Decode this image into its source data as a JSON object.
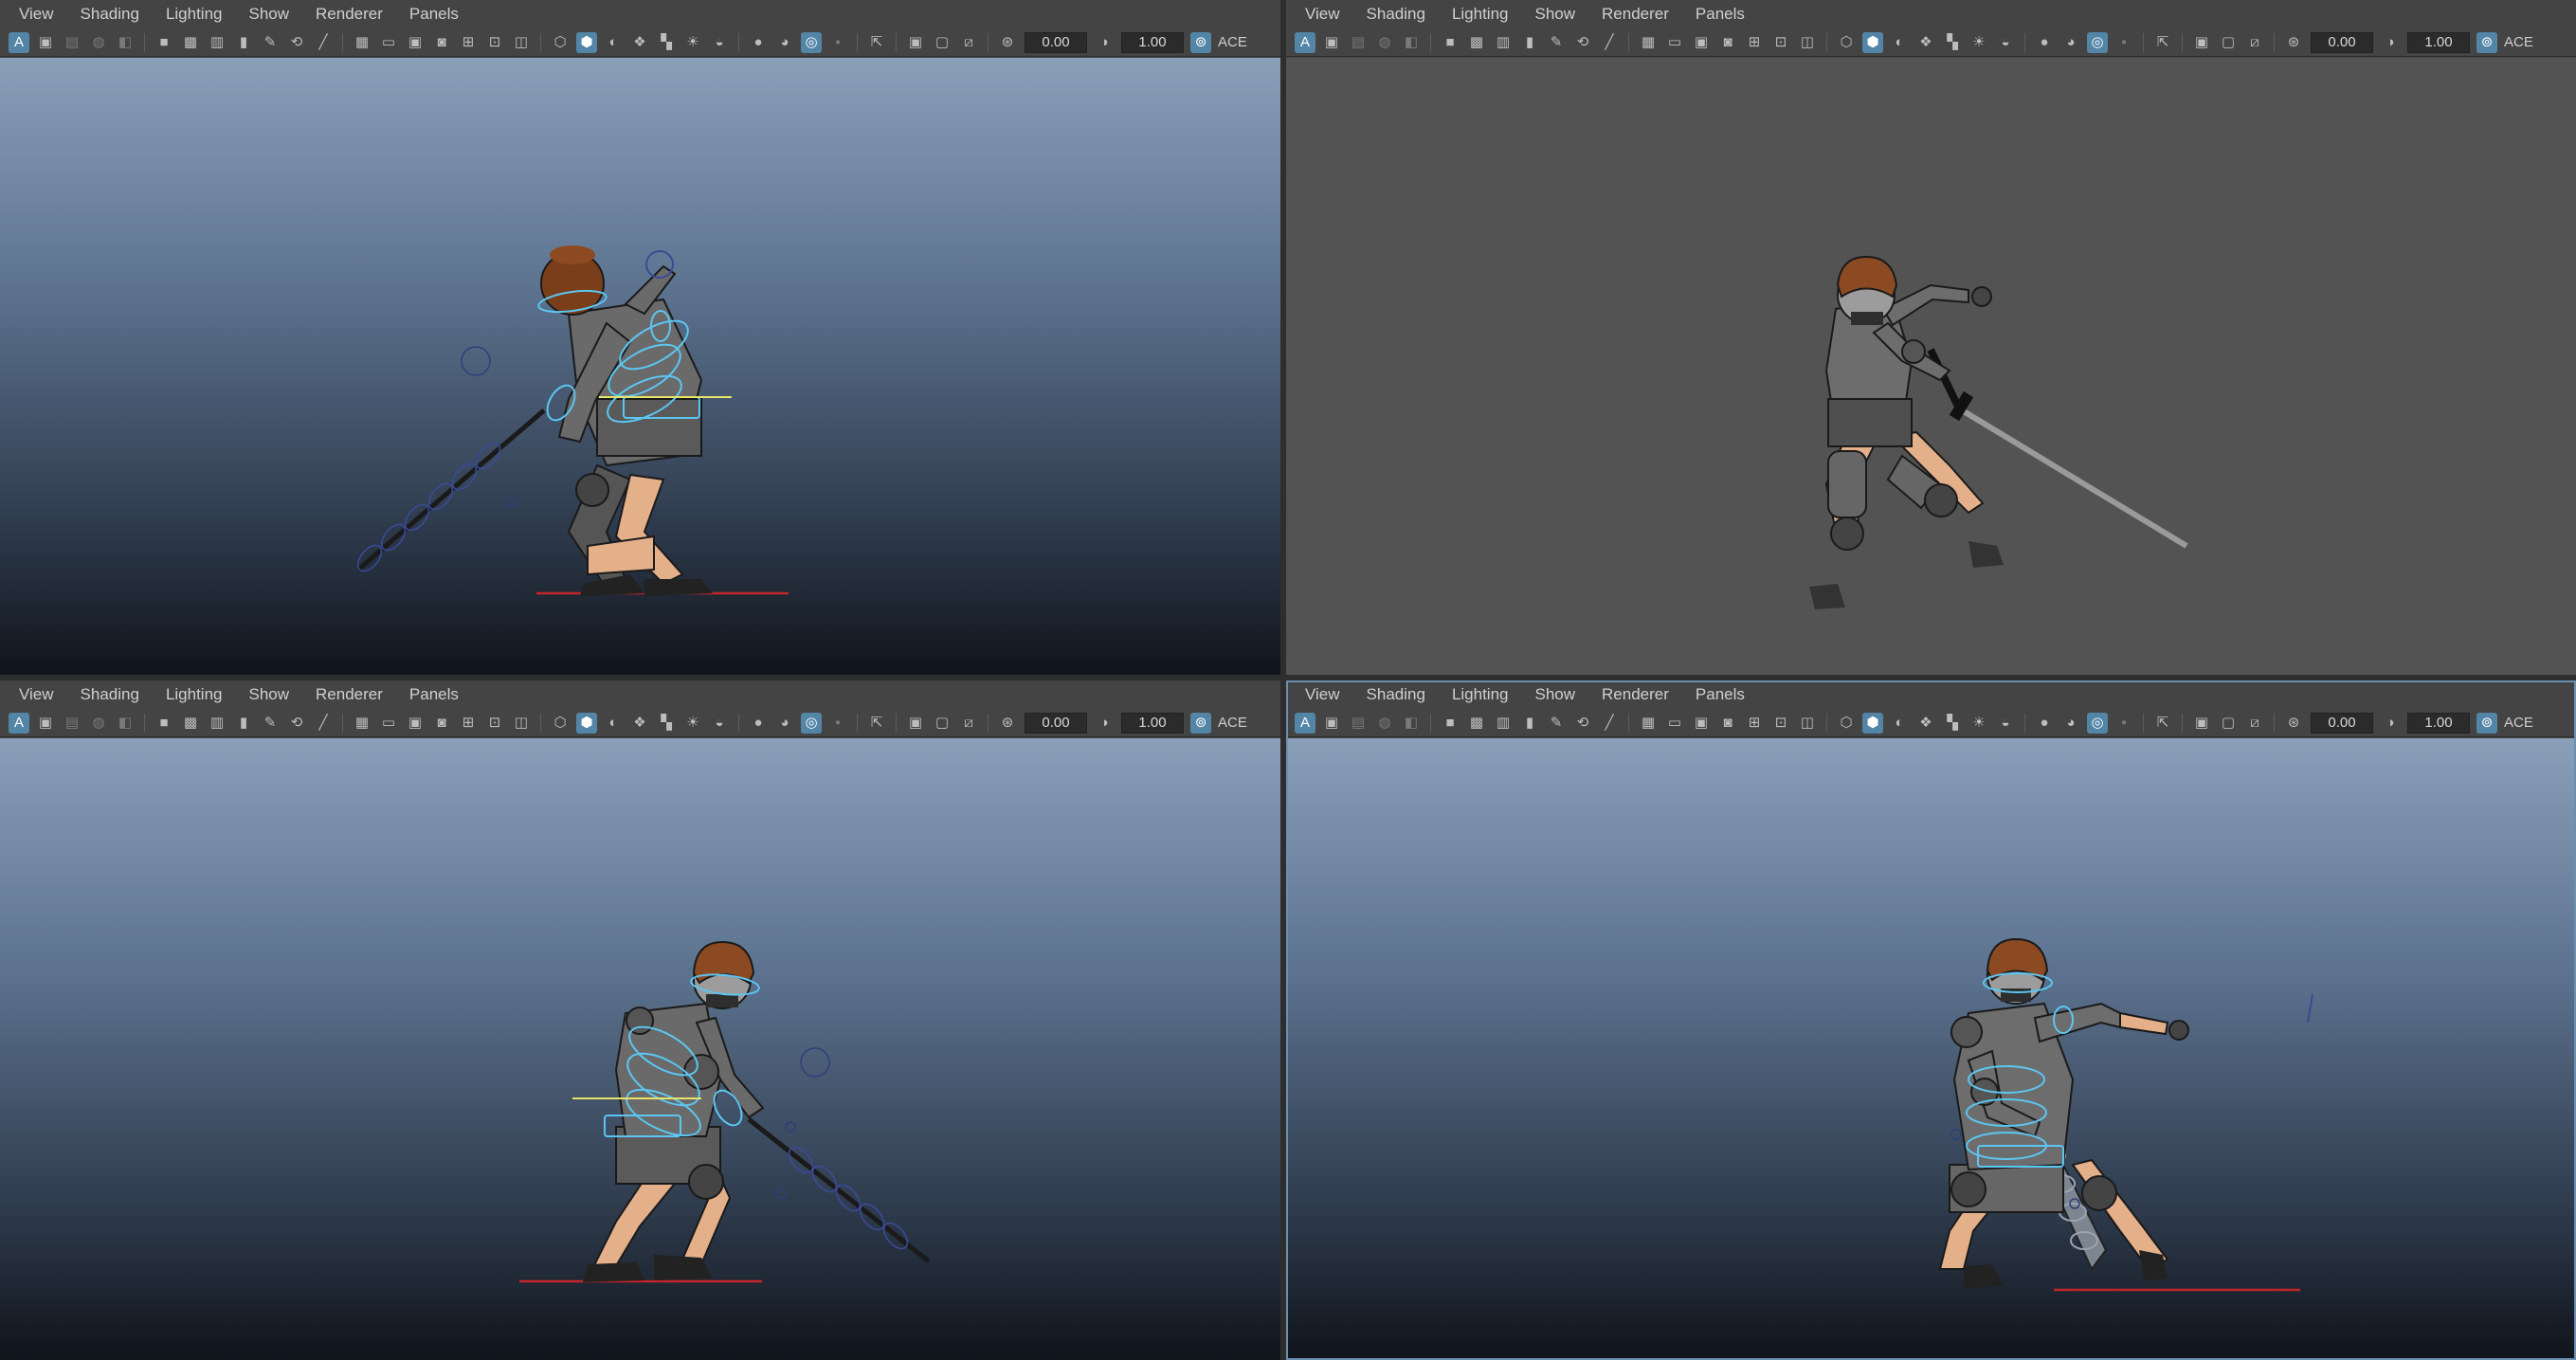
{
  "app": {
    "menus": [
      "View",
      "Shading",
      "Lighting",
      "Show",
      "Renderer",
      "Panels"
    ],
    "toolbar": {
      "exposure_value": "0.00",
      "gamma_value": "1.00",
      "color_mgmt_label": "ACE"
    },
    "toolbar_icons": [
      "select-camera-icon",
      "camera-attributes-icon",
      "bookmarks-icon",
      "image-plane-icon",
      "camera-icon",
      "grid-icon",
      "film-gate-icon",
      "resolution-gate-icon",
      "gate-mask-icon",
      "field-chart-icon",
      "safe-action-icon",
      "safe-title-icon",
      "wireframe-icon",
      "smooth-shade-icon",
      "textured-icon",
      "lighting-icon",
      "shadows-icon",
      "screen-ambient-occlusion-icon",
      "motion-blur-icon",
      "anti-aliasing-icon",
      "isolate-select-icon",
      "xray-icon",
      "xray-joints-icon",
      "exposure-icon",
      "gamma-icon",
      "color-management-icon"
    ],
    "viewports": [
      {
        "name": "top-left",
        "background": "gradient"
      },
      {
        "name": "top-right",
        "background": "flat"
      },
      {
        "name": "bottom-left",
        "background": "gradient"
      },
      {
        "name": "bottom-right",
        "background": "gradient"
      }
    ]
  }
}
